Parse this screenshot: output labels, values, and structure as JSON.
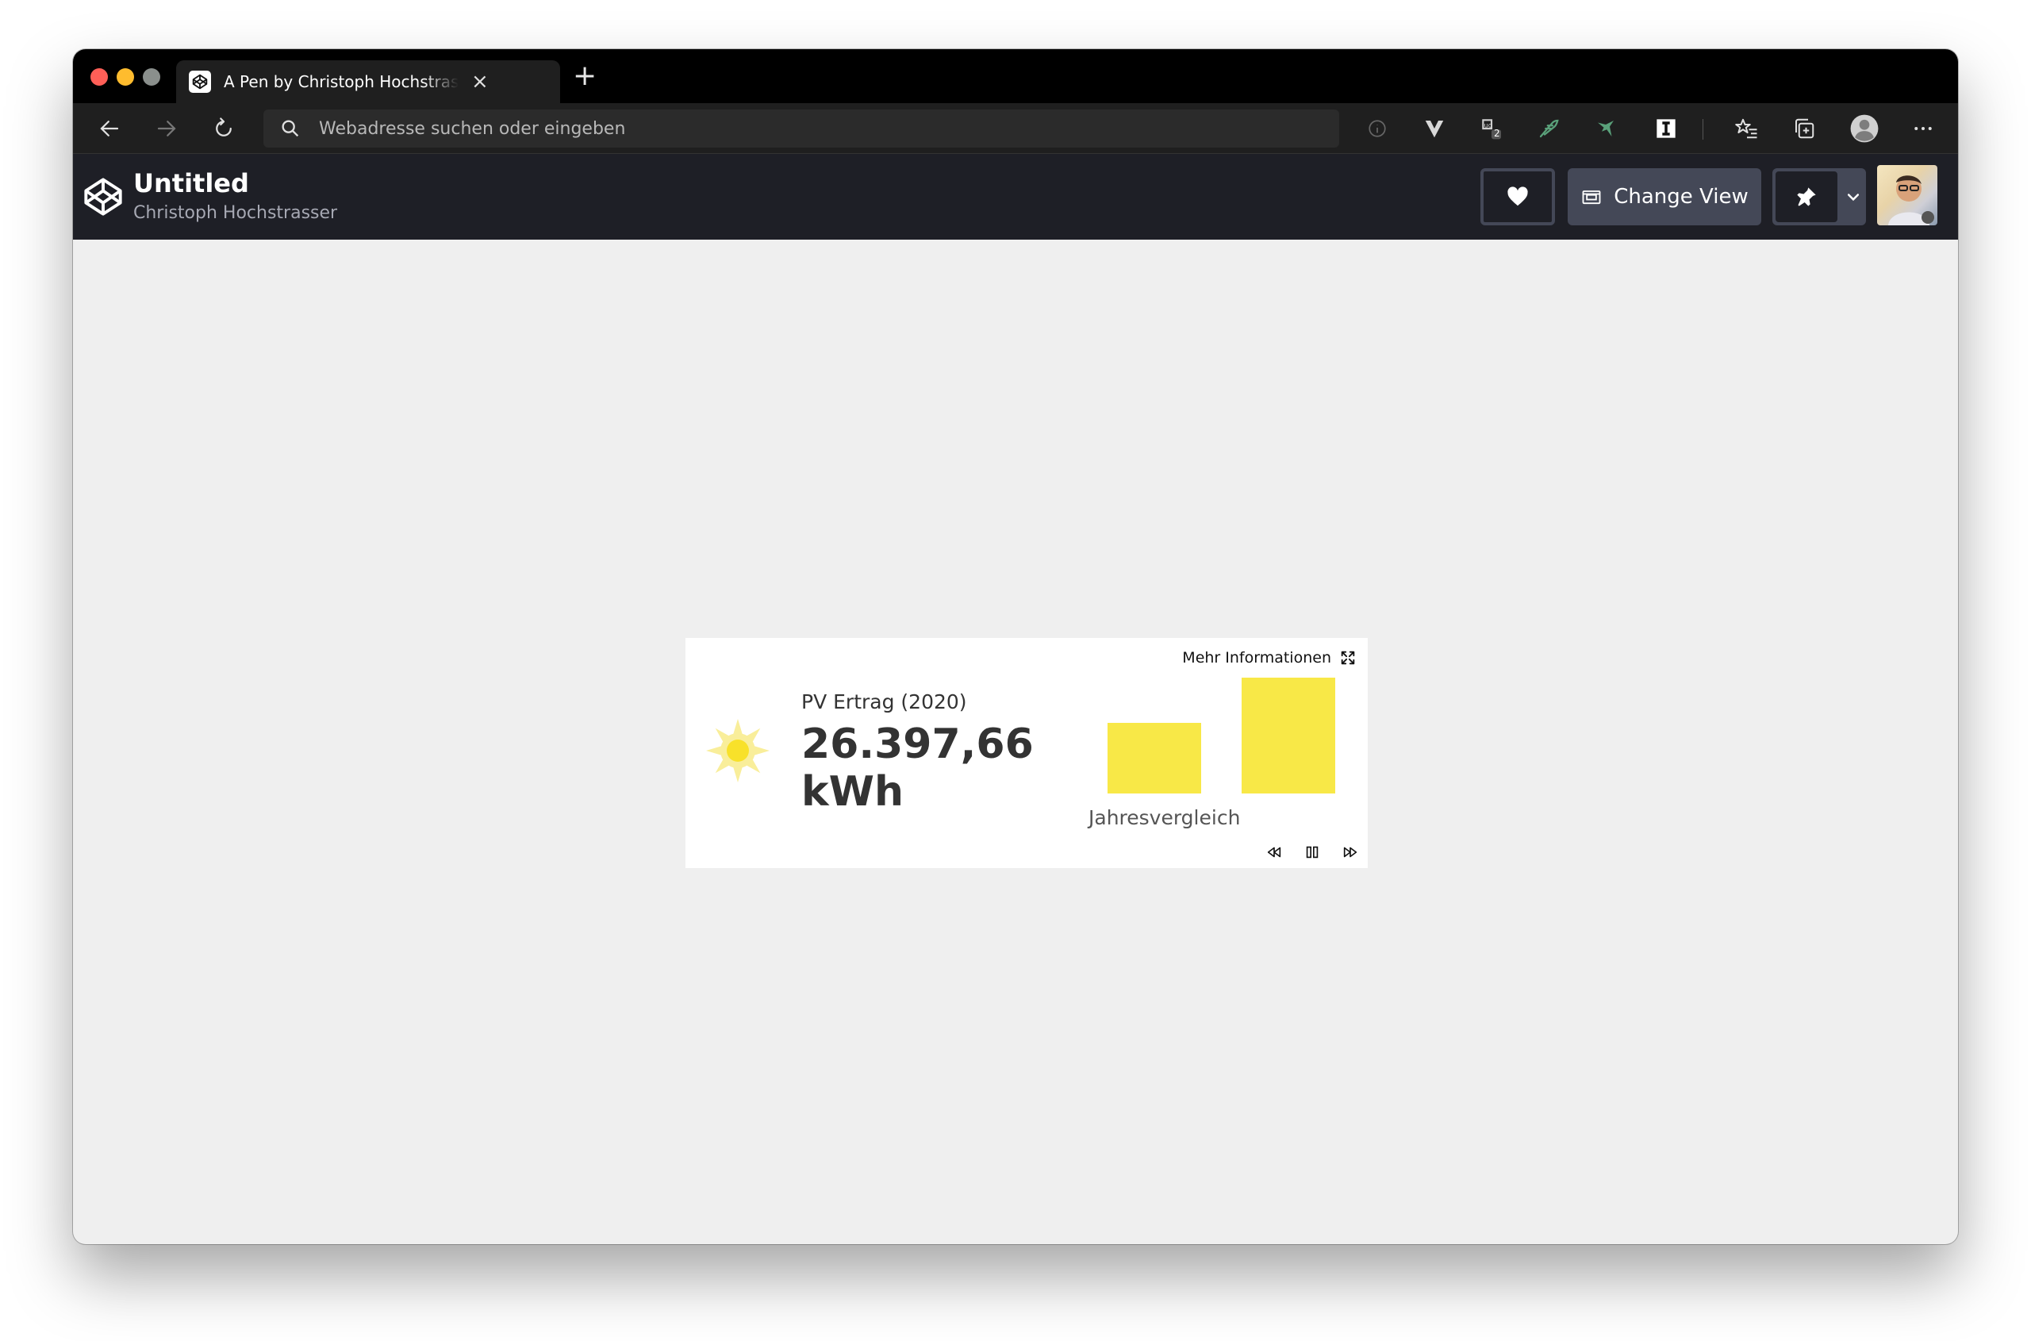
{
  "browser": {
    "tab_title": "A Pen by Christoph Hochstrasser",
    "url_placeholder": "Webadresse suchen oder eingeben",
    "badge_count": "2"
  },
  "codepen": {
    "title": "Untitled",
    "author": "Christoph Hochstrasser",
    "change_view_label": "Change View"
  },
  "widget": {
    "more_info_label": "Mehr Informationen",
    "pv_label": "PV Ertrag (2020)",
    "pv_value": "26.397,66",
    "pv_unit": "kWh",
    "chart_label": "Jahresvergleich",
    "accent_color": "#f8e847",
    "bars": [
      {
        "relative_value": 0.61
      },
      {
        "relative_value": 1.0
      }
    ]
  }
}
